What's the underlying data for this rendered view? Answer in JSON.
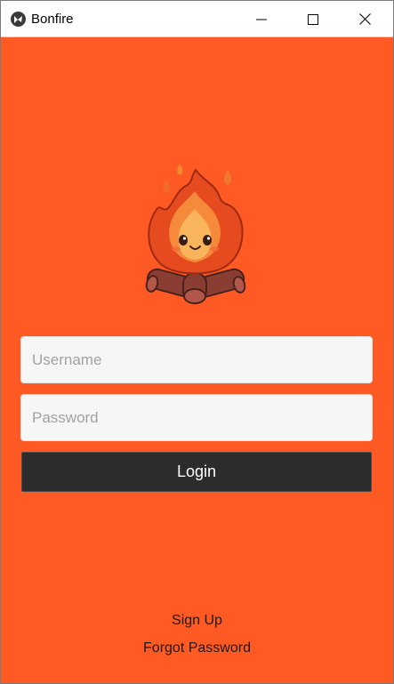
{
  "window": {
    "title": "Bonfire",
    "app_icon": "kivy-logo-icon",
    "controls": [
      "minimize-icon",
      "maximize-icon",
      "close-icon"
    ]
  },
  "colors": {
    "background": "#ff5a23",
    "button": "#2c2c2c",
    "field": "#f6f6f6"
  },
  "mascot": {
    "icon": "bonfire-mascot-icon"
  },
  "form": {
    "username_placeholder": "Username",
    "password_placeholder": "Password",
    "login_label": "Login"
  },
  "links": {
    "signup_label": "Sign Up",
    "forgot_label": "Forgot Password"
  }
}
